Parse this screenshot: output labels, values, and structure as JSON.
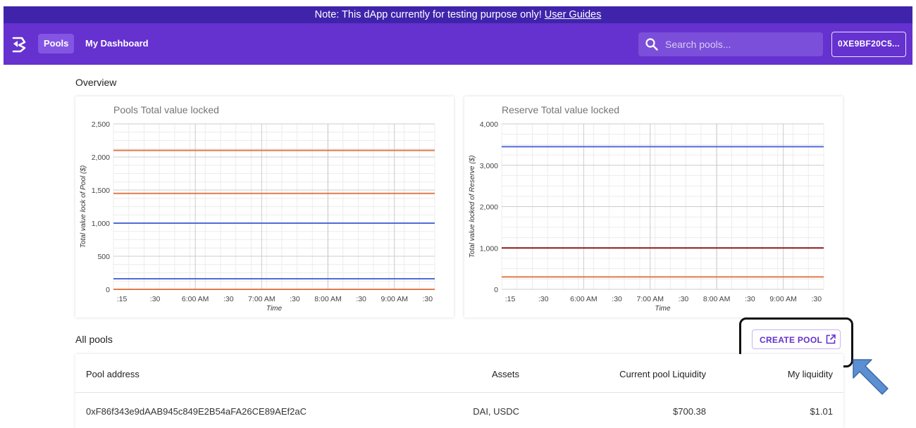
{
  "notice": {
    "text": "Note: This dApp currently for testing purpose only!",
    "link": "User Guides"
  },
  "nav": {
    "pools": "Pools",
    "dashboard": "My Dashboard"
  },
  "search": {
    "placeholder": "Search pools..."
  },
  "wallet": {
    "address": "0XE9BF20C5..."
  },
  "overview": {
    "heading": "Overview"
  },
  "colors": {
    "notice_bg": "#3f24ab",
    "appbar_bg": "#6531cf",
    "accent": "#6531cf",
    "blue_line": "#4f6bd8",
    "orange_line": "#e07a4a",
    "dark_red_line": "#8b1a1a"
  },
  "chart_data": [
    {
      "type": "line",
      "title": "Pools Total value locked",
      "xlabel": "Time",
      "ylabel": "Total value lock of Pool ($)",
      "ylim": [
        0,
        2500
      ],
      "yticks": [
        "0",
        "500",
        "1,000",
        "1,500",
        "2,000",
        "2,500"
      ],
      "xticks": [
        ":15",
        ":30",
        "6:00 AM",
        ":30",
        "7:00 AM",
        ":30",
        "8:00 AM",
        ":30",
        "9:00 AM",
        ":30"
      ],
      "grid": true,
      "series": [
        {
          "color": "#e07a4a",
          "values": [
            2100,
            2100
          ]
        },
        {
          "color": "#e07a4a",
          "values": [
            1450,
            1450
          ]
        },
        {
          "color": "#4f6bd8",
          "values": [
            1000,
            1000
          ]
        },
        {
          "color": "#4f6bd8",
          "values": [
            160,
            160
          ]
        },
        {
          "color": "#e07a4a",
          "values": [
            0,
            0
          ]
        }
      ]
    },
    {
      "type": "line",
      "title": "Reserve Total value locked",
      "xlabel": "Time",
      "ylabel": "Total value locked of Reserve ($)",
      "ylim": [
        0,
        4000
      ],
      "yticks": [
        "0",
        "1,000",
        "2,000",
        "3,000",
        "4,000"
      ],
      "xticks": [
        ":15",
        ":30",
        "6:00 AM",
        ":30",
        "7:00 AM",
        ":30",
        "8:00 AM",
        ":30",
        "9:00 AM",
        ":30"
      ],
      "grid": true,
      "series": [
        {
          "color": "#4f6bd8",
          "values": [
            3450,
            3450
          ]
        },
        {
          "color": "#8b1a1a",
          "values": [
            1000,
            1000
          ]
        },
        {
          "color": "#e07a4a",
          "values": [
            300,
            300
          ]
        }
      ]
    }
  ],
  "all_pools": {
    "heading": "All pools",
    "create_label": "CREATE POOL",
    "columns": [
      "Pool address",
      "Assets",
      "Current pool Liquidity",
      "My liquidity"
    ],
    "rows": [
      {
        "address": "0xF86f343e9dAAB945c849E2B54aFA26CE89AEf2aC",
        "assets": "DAI, USDC",
        "liquidity": "$700.38",
        "mine": "$1.01"
      }
    ]
  }
}
